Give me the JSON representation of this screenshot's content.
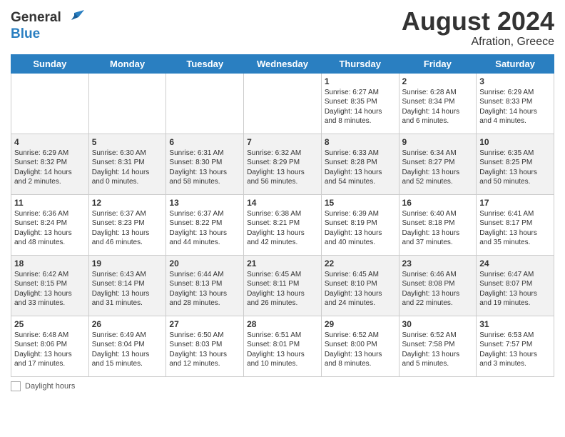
{
  "header": {
    "logo_line1": "General",
    "logo_line2": "Blue",
    "month_year": "August 2024",
    "location": "Afration, Greece"
  },
  "days_of_week": [
    "Sunday",
    "Monday",
    "Tuesday",
    "Wednesday",
    "Thursday",
    "Friday",
    "Saturday"
  ],
  "weeks": [
    [
      {
        "day": "",
        "text": ""
      },
      {
        "day": "",
        "text": ""
      },
      {
        "day": "",
        "text": ""
      },
      {
        "day": "",
        "text": ""
      },
      {
        "day": "1",
        "text": "Sunrise: 6:27 AM\nSunset: 8:35 PM\nDaylight: 14 hours\nand 8 minutes."
      },
      {
        "day": "2",
        "text": "Sunrise: 6:28 AM\nSunset: 8:34 PM\nDaylight: 14 hours\nand 6 minutes."
      },
      {
        "day": "3",
        "text": "Sunrise: 6:29 AM\nSunset: 8:33 PM\nDaylight: 14 hours\nand 4 minutes."
      }
    ],
    [
      {
        "day": "4",
        "text": "Sunrise: 6:29 AM\nSunset: 8:32 PM\nDaylight: 14 hours\nand 2 minutes."
      },
      {
        "day": "5",
        "text": "Sunrise: 6:30 AM\nSunset: 8:31 PM\nDaylight: 14 hours\nand 0 minutes."
      },
      {
        "day": "6",
        "text": "Sunrise: 6:31 AM\nSunset: 8:30 PM\nDaylight: 13 hours\nand 58 minutes."
      },
      {
        "day": "7",
        "text": "Sunrise: 6:32 AM\nSunset: 8:29 PM\nDaylight: 13 hours\nand 56 minutes."
      },
      {
        "day": "8",
        "text": "Sunrise: 6:33 AM\nSunset: 8:28 PM\nDaylight: 13 hours\nand 54 minutes."
      },
      {
        "day": "9",
        "text": "Sunrise: 6:34 AM\nSunset: 8:27 PM\nDaylight: 13 hours\nand 52 minutes."
      },
      {
        "day": "10",
        "text": "Sunrise: 6:35 AM\nSunset: 8:25 PM\nDaylight: 13 hours\nand 50 minutes."
      }
    ],
    [
      {
        "day": "11",
        "text": "Sunrise: 6:36 AM\nSunset: 8:24 PM\nDaylight: 13 hours\nand 48 minutes."
      },
      {
        "day": "12",
        "text": "Sunrise: 6:37 AM\nSunset: 8:23 PM\nDaylight: 13 hours\nand 46 minutes."
      },
      {
        "day": "13",
        "text": "Sunrise: 6:37 AM\nSunset: 8:22 PM\nDaylight: 13 hours\nand 44 minutes."
      },
      {
        "day": "14",
        "text": "Sunrise: 6:38 AM\nSunset: 8:21 PM\nDaylight: 13 hours\nand 42 minutes."
      },
      {
        "day": "15",
        "text": "Sunrise: 6:39 AM\nSunset: 8:19 PM\nDaylight: 13 hours\nand 40 minutes."
      },
      {
        "day": "16",
        "text": "Sunrise: 6:40 AM\nSunset: 8:18 PM\nDaylight: 13 hours\nand 37 minutes."
      },
      {
        "day": "17",
        "text": "Sunrise: 6:41 AM\nSunset: 8:17 PM\nDaylight: 13 hours\nand 35 minutes."
      }
    ],
    [
      {
        "day": "18",
        "text": "Sunrise: 6:42 AM\nSunset: 8:15 PM\nDaylight: 13 hours\nand 33 minutes."
      },
      {
        "day": "19",
        "text": "Sunrise: 6:43 AM\nSunset: 8:14 PM\nDaylight: 13 hours\nand 31 minutes."
      },
      {
        "day": "20",
        "text": "Sunrise: 6:44 AM\nSunset: 8:13 PM\nDaylight: 13 hours\nand 28 minutes."
      },
      {
        "day": "21",
        "text": "Sunrise: 6:45 AM\nSunset: 8:11 PM\nDaylight: 13 hours\nand 26 minutes."
      },
      {
        "day": "22",
        "text": "Sunrise: 6:45 AM\nSunset: 8:10 PM\nDaylight: 13 hours\nand 24 minutes."
      },
      {
        "day": "23",
        "text": "Sunrise: 6:46 AM\nSunset: 8:08 PM\nDaylight: 13 hours\nand 22 minutes."
      },
      {
        "day": "24",
        "text": "Sunrise: 6:47 AM\nSunset: 8:07 PM\nDaylight: 13 hours\nand 19 minutes."
      }
    ],
    [
      {
        "day": "25",
        "text": "Sunrise: 6:48 AM\nSunset: 8:06 PM\nDaylight: 13 hours\nand 17 minutes."
      },
      {
        "day": "26",
        "text": "Sunrise: 6:49 AM\nSunset: 8:04 PM\nDaylight: 13 hours\nand 15 minutes."
      },
      {
        "day": "27",
        "text": "Sunrise: 6:50 AM\nSunset: 8:03 PM\nDaylight: 13 hours\nand 12 minutes."
      },
      {
        "day": "28",
        "text": "Sunrise: 6:51 AM\nSunset: 8:01 PM\nDaylight: 13 hours\nand 10 minutes."
      },
      {
        "day": "29",
        "text": "Sunrise: 6:52 AM\nSunset: 8:00 PM\nDaylight: 13 hours\nand 8 minutes."
      },
      {
        "day": "30",
        "text": "Sunrise: 6:52 AM\nSunset: 7:58 PM\nDaylight: 13 hours\nand 5 minutes."
      },
      {
        "day": "31",
        "text": "Sunrise: 6:53 AM\nSunset: 7:57 PM\nDaylight: 13 hours\nand 3 minutes."
      }
    ]
  ],
  "footer": {
    "label": "Daylight hours"
  }
}
